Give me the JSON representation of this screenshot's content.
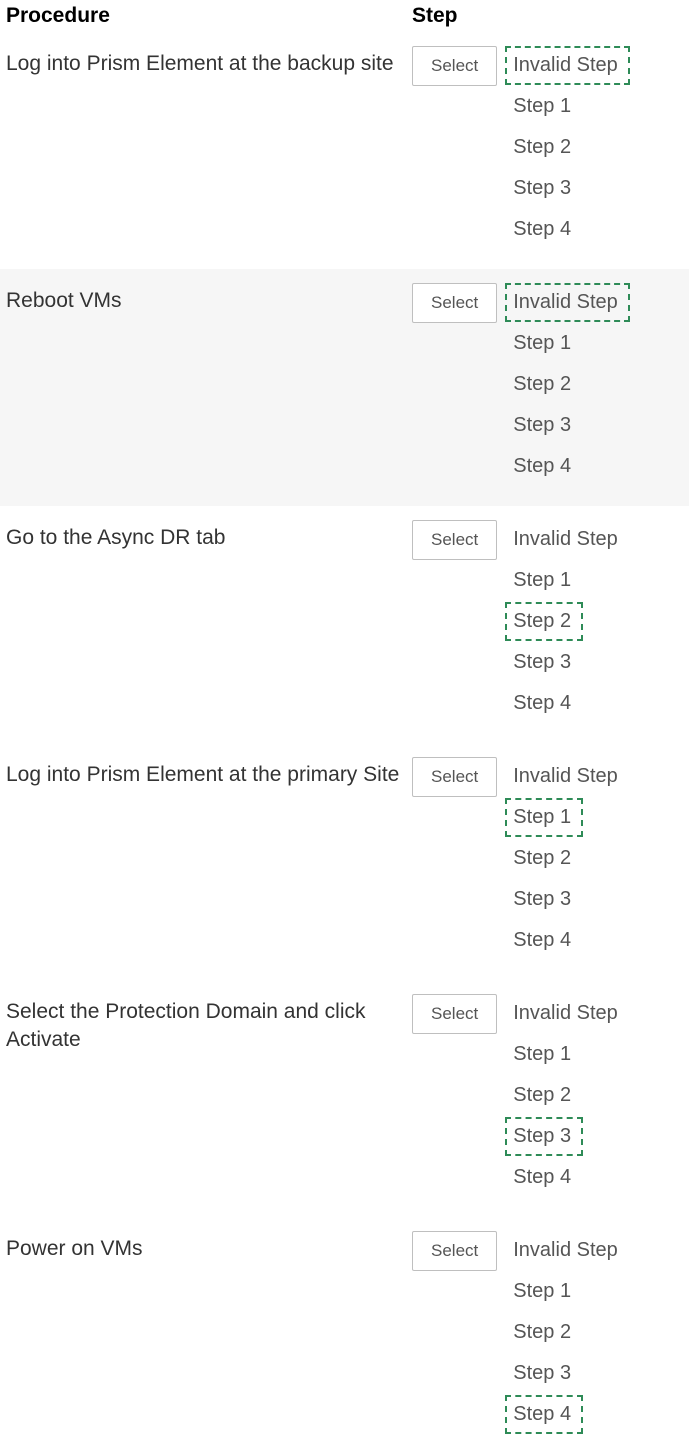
{
  "headers": {
    "procedure": "Procedure",
    "step": "Step"
  },
  "select_label": "Select",
  "rows": [
    {
      "procedure": "Log into Prism Element at the backup site",
      "alt": false,
      "options": [
        {
          "label": "Invalid Step",
          "highlighted": true
        },
        {
          "label": "Step 1",
          "highlighted": false
        },
        {
          "label": "Step 2",
          "highlighted": false
        },
        {
          "label": "Step 3",
          "highlighted": false
        },
        {
          "label": "Step 4",
          "highlighted": false
        }
      ]
    },
    {
      "procedure": "Reboot VMs",
      "alt": true,
      "options": [
        {
          "label": "Invalid Step",
          "highlighted": true
        },
        {
          "label": "Step 1",
          "highlighted": false
        },
        {
          "label": "Step 2",
          "highlighted": false
        },
        {
          "label": "Step 3",
          "highlighted": false
        },
        {
          "label": "Step 4",
          "highlighted": false
        }
      ]
    },
    {
      "procedure": "Go to the Async DR tab",
      "alt": false,
      "options": [
        {
          "label": "Invalid Step",
          "highlighted": false
        },
        {
          "label": "Step 1",
          "highlighted": false
        },
        {
          "label": "Step 2",
          "highlighted": true
        },
        {
          "label": "Step 3",
          "highlighted": false
        },
        {
          "label": "Step 4",
          "highlighted": false
        }
      ]
    },
    {
      "procedure": "Log into Prism Element at the primary Site",
      "alt": false,
      "options": [
        {
          "label": "Invalid Step",
          "highlighted": false
        },
        {
          "label": "Step 1",
          "highlighted": true
        },
        {
          "label": "Step 2",
          "highlighted": false
        },
        {
          "label": "Step 3",
          "highlighted": false
        },
        {
          "label": "Step 4",
          "highlighted": false
        }
      ]
    },
    {
      "procedure": "Select the Protection Domain and click Activate",
      "alt": false,
      "options": [
        {
          "label": "Invalid Step",
          "highlighted": false
        },
        {
          "label": "Step 1",
          "highlighted": false
        },
        {
          "label": "Step 2",
          "highlighted": false
        },
        {
          "label": "Step 3",
          "highlighted": true
        },
        {
          "label": "Step 4",
          "highlighted": false
        }
      ]
    },
    {
      "procedure": "Power on VMs",
      "alt": false,
      "options": [
        {
          "label": "Invalid Step",
          "highlighted": false
        },
        {
          "label": "Step 1",
          "highlighted": false
        },
        {
          "label": "Step 2",
          "highlighted": false
        },
        {
          "label": "Step 3",
          "highlighted": false
        },
        {
          "label": "Step 4",
          "highlighted": true
        }
      ]
    }
  ]
}
